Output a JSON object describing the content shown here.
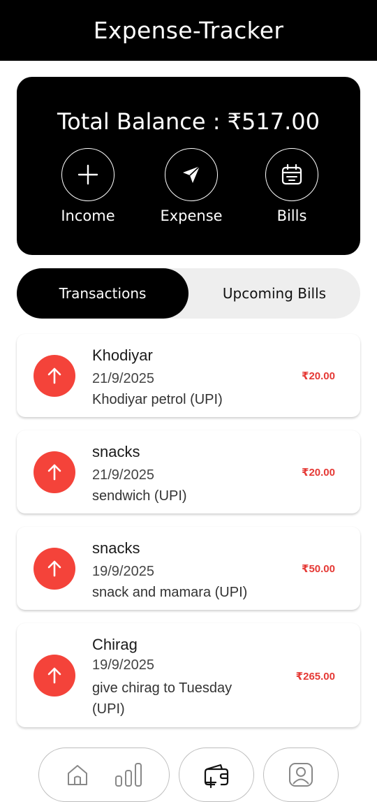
{
  "app": {
    "title": "Expense-Tracker"
  },
  "balance": {
    "text": "Total Balance : ₹517.00"
  },
  "actions": [
    {
      "label": "Income",
      "icon": "plus-icon"
    },
    {
      "label": "Expense",
      "icon": "send-icon"
    },
    {
      "label": "Bills",
      "icon": "calendar-icon"
    }
  ],
  "tabs": {
    "active": "Transactions",
    "inactive": "Upcoming Bills"
  },
  "transactions": [
    {
      "title": "Khodiyar",
      "date": "21/9/2025",
      "note": "Khodiyar petrol (UPI)",
      "amount": "₹20.00"
    },
    {
      "title": "snacks",
      "date": "21/9/2025",
      "note": "sendwich (UPI)",
      "amount": "₹20.00"
    },
    {
      "title": "snacks",
      "date": "19/9/2025",
      "note": "snack and mamara (UPI)",
      "amount": "₹50.00"
    },
    {
      "title": "Chirag",
      "date": "19/9/2025",
      "note": "give chirag to Tuesday (UPI)",
      "amount": "₹265.00"
    }
  ],
  "colors": {
    "expense_red": "#f4433a",
    "amount_red": "#e53935",
    "primary": "#000000"
  },
  "bottom_nav": {
    "icons": [
      "home-icon",
      "stats-icon",
      "add-wallet-icon",
      "profile-icon"
    ]
  }
}
